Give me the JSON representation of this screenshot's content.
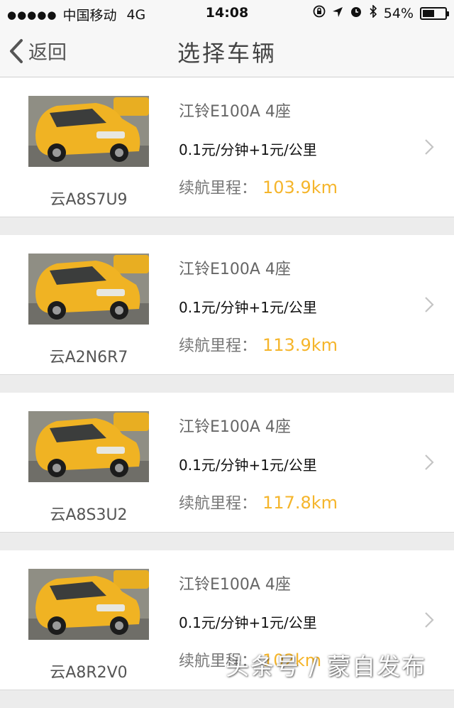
{
  "status_bar": {
    "signal": "●●●●●",
    "carrier": "中国移动",
    "network": "4G",
    "time": "14:08",
    "battery": "54%",
    "battery_level": 0.54
  },
  "nav": {
    "back_label": "返回",
    "title": "选择车辆"
  },
  "cars": [
    {
      "plate": "云A8S7U9",
      "model": "江铃E100A 4座",
      "price": "0.1元/分钟+1元/公里",
      "range_label": "续航里程：",
      "range": "103.9km"
    },
    {
      "plate": "云A2N6R7",
      "model": "江铃E100A 4座",
      "price": "0.1元/分钟+1元/公里",
      "range_label": "续航里程：",
      "range": "113.9km"
    },
    {
      "plate": "云A8S3U2",
      "model": "江铃E100A 4座",
      "price": "0.1元/分钟+1元/公里",
      "range_label": "续航里程：",
      "range": "117.8km"
    },
    {
      "plate": "云A8R2V0",
      "model": "江铃E100A 4座",
      "price": "0.1元/分钟+1元/公里",
      "range_label": "续航里程：",
      "range": "102km"
    }
  ],
  "watermark": "头条号 / 蒙自发布",
  "colors": {
    "accent": "#f5b52b",
    "nav_bg": "#f7f7f7",
    "page_bg": "#ececec"
  }
}
